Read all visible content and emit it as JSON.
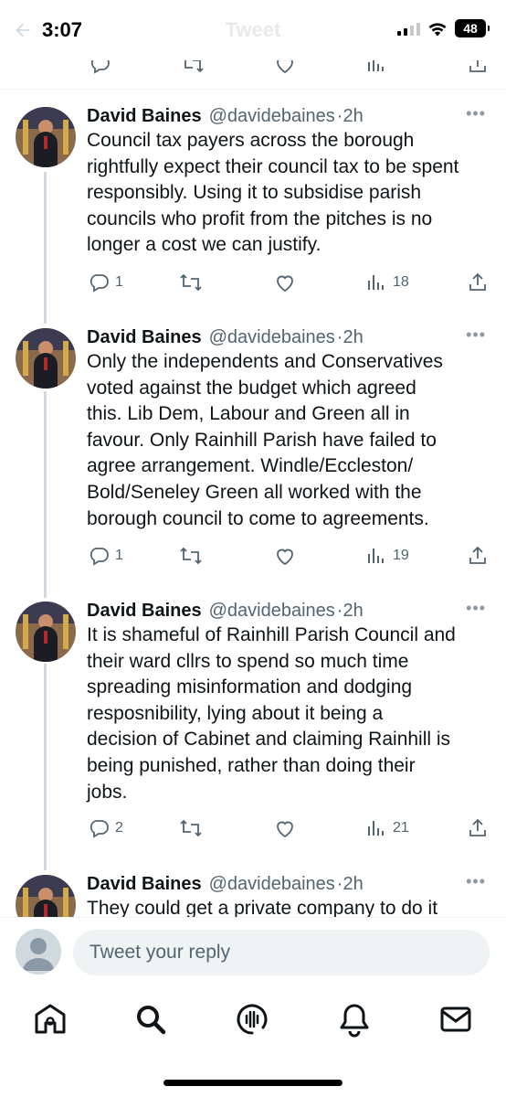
{
  "status_bar": {
    "time": "3:07",
    "battery": "48"
  },
  "header": {
    "back_icon": "arrow-left-icon",
    "title": "Tweet"
  },
  "tweets": [
    {
      "name": "David Baines",
      "handle": "@davidebaines",
      "time": "2h",
      "text": "Council tax payers across the borough\nrightfully expect their council tax to be spent\nresponsibly. Using it to subsidise parish\ncouncils who profit from the pitches is no\nlonger a cost we can justify.",
      "replies": "1",
      "retweets": "",
      "likes": "",
      "views": "18"
    },
    {
      "name": "David Baines",
      "handle": "@davidebaines",
      "time": "2h",
      "text": "Only the independents and Conservatives\nvoted against the budget which agreed\nthis. Lib Dem, Labour and Green all in\nfavour. Only Rainhill Parish have failed to\nagree arrangement. Windle/Eccleston/\nBold/Seneley Green all worked with the\nborough council to come to agreements.",
      "replies": "1",
      "retweets": "",
      "likes": "",
      "views": "19"
    },
    {
      "name": "David Baines",
      "handle": "@davidebaines",
      "time": "2h",
      "text": "It is shameful of Rainhill Parish Council and\ntheir ward cllrs to spend so much time\nspreading misinformation and dodging\nresposnibility, lying about it being a\ndecision of Cabinet and claiming Rainhill is\nbeing punished, rather than doing their\njobs.",
      "replies": "2",
      "retweets": "",
      "likes": "",
      "views": "21"
    },
    {
      "name": "David Baines",
      "handle": "@davidebaines",
      "time": "2h",
      "text": "They could get a private company to do it"
    }
  ],
  "reply_bar": {
    "placeholder": "Tweet your reply"
  },
  "tab_bar": [
    "home-icon",
    "search-icon",
    "spaces-icon",
    "notifications-icon",
    "messages-icon"
  ],
  "colors": {
    "text": "#0f1419",
    "secondary": "#536471",
    "thread_line": "#cfd9de",
    "reply_bg": "#eff3f4"
  }
}
